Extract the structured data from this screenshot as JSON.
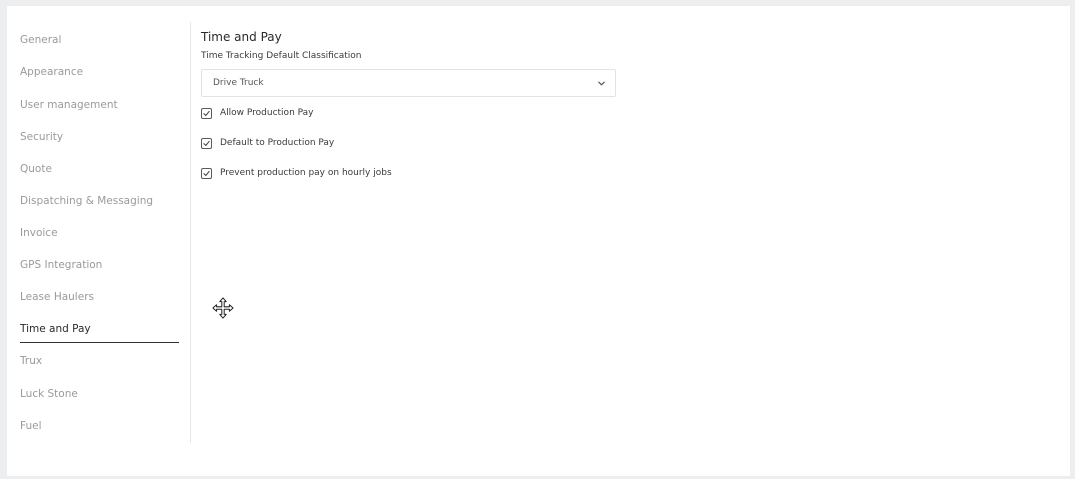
{
  "sidebar": {
    "items": [
      {
        "label": "General"
      },
      {
        "label": "Appearance"
      },
      {
        "label": "User management"
      },
      {
        "label": "Security"
      },
      {
        "label": "Quote"
      },
      {
        "label": "Dispatching & Messaging"
      },
      {
        "label": "Invoice"
      },
      {
        "label": "GPS Integration"
      },
      {
        "label": "Lease Haulers"
      },
      {
        "label": "Time and Pay"
      },
      {
        "label": "Trux"
      },
      {
        "label": "Luck Stone"
      },
      {
        "label": "Fuel"
      }
    ],
    "active": "Time and Pay"
  },
  "main": {
    "title": "Time and Pay",
    "classification": {
      "label": "Time Tracking Default Classification",
      "value": "Drive Truck"
    },
    "options": [
      {
        "label": "Allow Production Pay",
        "checked": true
      },
      {
        "label": "Default to Production Pay",
        "checked": true
      },
      {
        "label": "Prevent production pay on hourly jobs",
        "checked": true
      }
    ]
  },
  "icons": {
    "dropdown": "chevron-down-icon",
    "checkbox": "checkmark-icon",
    "cursor": "move-cursor-icon"
  },
  "colors": {
    "background": "#edeef0",
    "panel": "#ffffff",
    "text_active": "#2a2a2a",
    "text_muted": "#9a9a9a"
  }
}
